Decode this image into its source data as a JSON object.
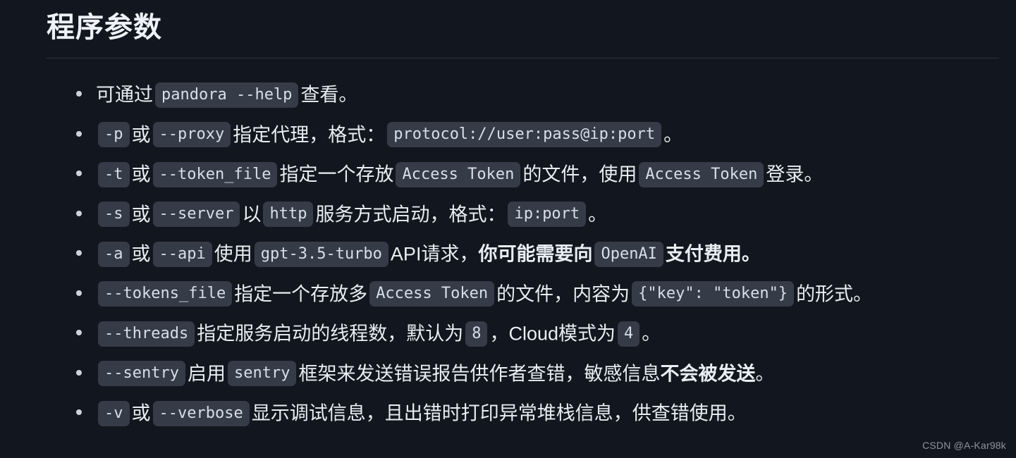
{
  "page": {
    "title": "程序参数",
    "background_color": "#12161e",
    "text_color": "#e9edf3",
    "code_chip_bg": "#353b47",
    "code_chip_fg": "#d9dfe9"
  },
  "watermark": "CSDN @A-Kar98k",
  "arg_list": [
    {
      "id": "help",
      "parts": [
        {
          "kind": "text",
          "value": "可通过"
        },
        {
          "kind": "code",
          "value": "pandora --help"
        },
        {
          "kind": "text",
          "value": "查看。"
        }
      ]
    },
    {
      "id": "proxy",
      "parts": [
        {
          "kind": "code",
          "value": "-p"
        },
        {
          "kind": "text",
          "value": "或"
        },
        {
          "kind": "code",
          "value": "--proxy"
        },
        {
          "kind": "text",
          "value": "指定代理，格式："
        },
        {
          "kind": "code",
          "value": "protocol://user:pass@ip:port"
        },
        {
          "kind": "text",
          "value": "。"
        }
      ]
    },
    {
      "id": "token-file",
      "parts": [
        {
          "kind": "code",
          "value": "-t"
        },
        {
          "kind": "text",
          "value": "或"
        },
        {
          "kind": "code",
          "value": "--token_file"
        },
        {
          "kind": "text",
          "value": "指定一个存放"
        },
        {
          "kind": "code",
          "value": "Access Token"
        },
        {
          "kind": "text",
          "value": "的文件，使用"
        },
        {
          "kind": "code",
          "value": "Access Token"
        },
        {
          "kind": "text",
          "value": "登录。"
        }
      ]
    },
    {
      "id": "server",
      "parts": [
        {
          "kind": "code",
          "value": "-s"
        },
        {
          "kind": "text",
          "value": "或"
        },
        {
          "kind": "code",
          "value": "--server"
        },
        {
          "kind": "text",
          "value": "以"
        },
        {
          "kind": "code",
          "value": "http"
        },
        {
          "kind": "text",
          "value": "服务方式启动，格式："
        },
        {
          "kind": "code",
          "value": "ip:port"
        },
        {
          "kind": "text",
          "value": "。"
        }
      ]
    },
    {
      "id": "api",
      "parts": [
        {
          "kind": "code",
          "value": "-a"
        },
        {
          "kind": "text",
          "value": "或"
        },
        {
          "kind": "code",
          "value": "--api"
        },
        {
          "kind": "text",
          "value": "使用"
        },
        {
          "kind": "code",
          "value": "gpt-3.5-turbo"
        },
        {
          "kind": "text",
          "value": "API请求，"
        },
        {
          "kind": "bold",
          "value": "你可能需要向"
        },
        {
          "kind": "code",
          "value": "OpenAI"
        },
        {
          "kind": "bold",
          "value": "支付费用。"
        }
      ]
    },
    {
      "id": "tokens-file",
      "parts": [
        {
          "kind": "code",
          "value": "--tokens_file"
        },
        {
          "kind": "text",
          "value": "指定一个存放多"
        },
        {
          "kind": "code",
          "value": "Access Token"
        },
        {
          "kind": "text",
          "value": "的文件，内容为"
        },
        {
          "kind": "code",
          "value": "{\"key\": \"token\"}"
        },
        {
          "kind": "text",
          "value": "的形式。"
        }
      ]
    },
    {
      "id": "threads",
      "parts": [
        {
          "kind": "code",
          "value": "--threads"
        },
        {
          "kind": "text",
          "value": "指定服务启动的线程数，默认为"
        },
        {
          "kind": "code",
          "value": "8"
        },
        {
          "kind": "text",
          "value": "，Cloud模式为"
        },
        {
          "kind": "code",
          "value": "4"
        },
        {
          "kind": "text",
          "value": "。"
        }
      ]
    },
    {
      "id": "sentry",
      "parts": [
        {
          "kind": "code",
          "value": "--sentry"
        },
        {
          "kind": "text",
          "value": "启用"
        },
        {
          "kind": "code",
          "value": "sentry"
        },
        {
          "kind": "text",
          "value": "框架来发送错误报告供作者查错，敏感信息"
        },
        {
          "kind": "bold",
          "value": "不会被发送"
        },
        {
          "kind": "text",
          "value": "。"
        }
      ]
    },
    {
      "id": "verbose",
      "parts": [
        {
          "kind": "code",
          "value": "-v"
        },
        {
          "kind": "text",
          "value": "或"
        },
        {
          "kind": "code",
          "value": "--verbose"
        },
        {
          "kind": "text",
          "value": "显示调试信息，且出错时打印异常堆栈信息，供查错使用。"
        }
      ]
    }
  ]
}
